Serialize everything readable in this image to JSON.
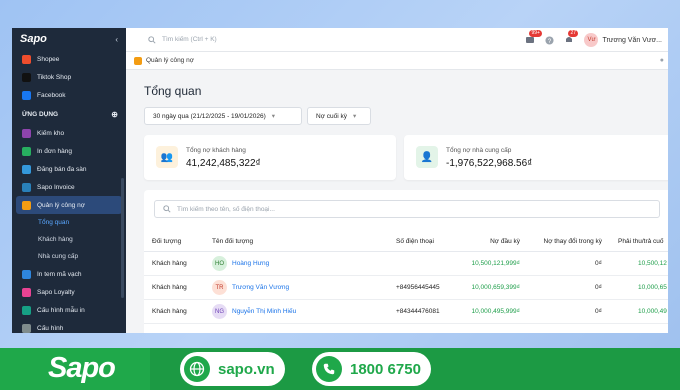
{
  "sidebar": {
    "logo": "Sapo",
    "collapse": "‹",
    "channels": [
      {
        "label": "Shopee",
        "color": "#ee4d2d"
      },
      {
        "label": "Tiktok Shop",
        "color": "#111111"
      },
      {
        "label": "Facebook",
        "color": "#1877f2"
      }
    ],
    "section_title": "ỨNG DỤNG",
    "section_add": "⊕",
    "apps": [
      {
        "label": "Kiếm kho",
        "color": "#8e44ad"
      },
      {
        "label": "In đơn hàng",
        "color": "#27ae60"
      },
      {
        "label": "Đăng bán đa sàn",
        "color": "#3498db"
      },
      {
        "label": "Sapo Invoice",
        "color": "#2980b9"
      },
      {
        "label": "Quản lý công nợ",
        "color": "#f39c12",
        "active": true
      }
    ],
    "sub_items": [
      {
        "label": "Tổng quan",
        "active": true
      },
      {
        "label": "Khách hàng"
      },
      {
        "label": "Nhà cung cấp"
      }
    ],
    "more_apps": [
      {
        "label": "In tem mã vạch",
        "color": "#2e86de"
      },
      {
        "label": "Sapo Loyalty",
        "color": "#e84393"
      },
      {
        "label": "Cấu hình mẫu in",
        "color": "#16a085"
      },
      {
        "label": "Cấu hình",
        "color": "#7f8c8d"
      }
    ]
  },
  "topbar": {
    "search_placeholder": "Tìm kiếm (Ctrl + K)",
    "badge1": "99+",
    "badge2": "27",
    "user_initials": "Vư",
    "user_name": "Trương Văn Vươ..."
  },
  "tab": {
    "label": "Quản lý công nợ"
  },
  "page": {
    "title": "Tổng quan",
    "date_filter": "30 ngày qua (21/12/2025 - 19/01/2026)",
    "type_filter": "Nợ cuối kỳ"
  },
  "cards": [
    {
      "label": "Tổng nợ khách hàng",
      "value": "41,242,485,322₫",
      "bg": "#fdf1dc",
      "color": "#f39c12"
    },
    {
      "label": "Tổng nợ nhà cung cấp",
      "value": "-1,976,522,968.56₫",
      "bg": "#e3f4e8",
      "color": "#27ae60"
    }
  ],
  "table": {
    "search_placeholder": "Tìm kiếm theo tên, số điện thoại...",
    "headers": [
      "Đối tượng",
      "Tên đối tượng",
      "Số điện thoại",
      "Nợ đầu kỳ",
      "Nợ thay đổi trong kỳ",
      "Phải thu/trả cuố"
    ],
    "rows": [
      {
        "type": "Khách hàng",
        "initials": "HO",
        "ava_bg": "#d7f0dc",
        "ava_color": "#2e7d32",
        "name": "Hoàng Hưng",
        "phone": "",
        "opening": "10,500,121,999₫",
        "change": "0₫",
        "closing": "10,500,12"
      },
      {
        "type": "Khách hàng",
        "initials": "TR",
        "ava_bg": "#fde0d6",
        "ava_color": "#c0392b",
        "name": "Trương Văn Vương",
        "phone": "+84956445445",
        "opening": "10,000,659,399₫",
        "change": "0₫",
        "closing": "10,000,65"
      },
      {
        "type": "Khách hàng",
        "initials": "NG",
        "ava_bg": "#e6dcf5",
        "ava_color": "#6c3fb5",
        "name": "Nguyễn Thị Minh Hiếu",
        "phone": "+84344476081",
        "opening": "10,000,495,999₫",
        "change": "0₫",
        "closing": "10,000,49"
      }
    ]
  },
  "footer": {
    "brand": "Sapo",
    "website": "sapo.vn",
    "hotline": "1800 6750"
  }
}
